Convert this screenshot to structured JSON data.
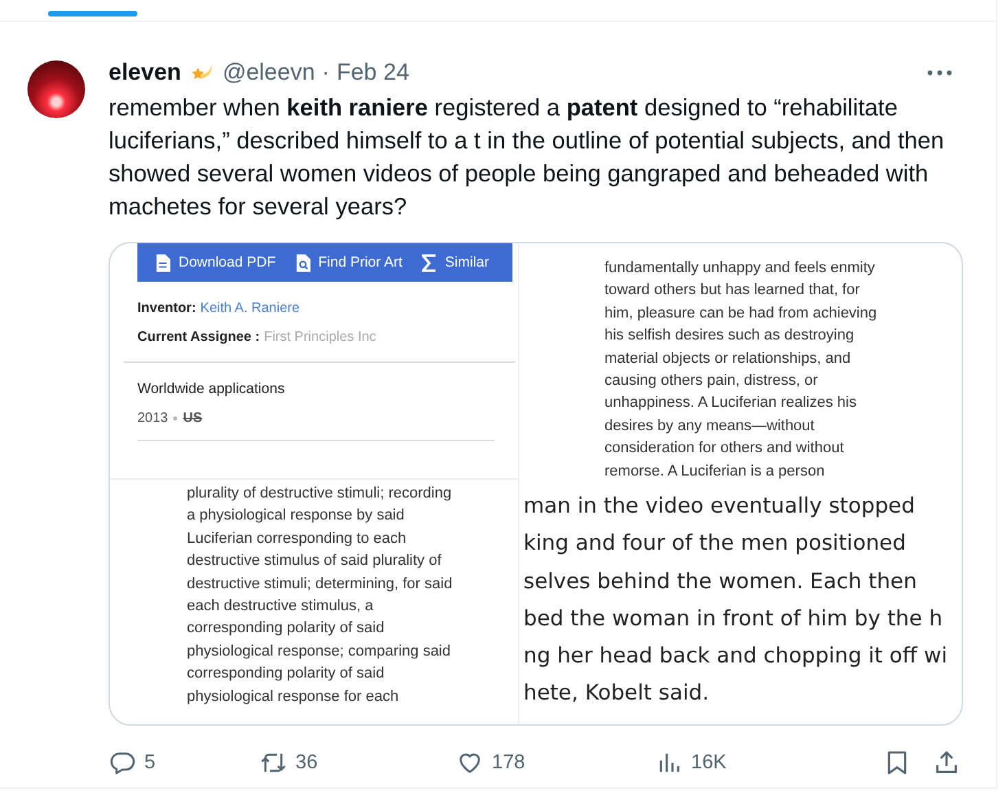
{
  "tweet": {
    "author": "eleven",
    "handle": "@eleevn",
    "separator": "·",
    "date": "Feb 24",
    "text": "remember when **keith raniere** registered a **patent** designed to “rehabilitate luciferians,” described himself to a t in the outline of potential subjects, and then showed several women videos of people being gangraped and beheaded with machetes for several years?"
  },
  "media": {
    "patent_page": {
      "toolbar": [
        {
          "kind": "document",
          "label": "Download PDF"
        },
        {
          "kind": "search",
          "label": "Find Prior Art"
        },
        {
          "kind": "sigma",
          "label": "Similar"
        }
      ],
      "fields": [
        {
          "label": "Inventor:",
          "value": "Keith A. Raniere",
          "kind": "link"
        },
        {
          "label": "Current Assignee :",
          "value": "First Principles Inc",
          "kind": "muted"
        }
      ],
      "section_title": "Worldwide applications",
      "year": "2013",
      "country": "US"
    },
    "description_lines": [
      "fundamentally unhappy and feels enmity",
      "toward others but has learned that, for",
      "him, pleasure can be had from achieving",
      "his selfish desires such as destroying",
      "material objects or relationships, and",
      "causing others pain, distress, or",
      "unhappiness. A Luciferian realizes his",
      "desires by any means—without",
      "consideration for others and without",
      "remorse. A Luciferian is a person"
    ],
    "claim_lines": [
      "plurality of destructive stimuli; recording",
      "a physiological response by said",
      "Luciferian corresponding to each",
      "destructive stimulus of said plurality of",
      "destructive stimuli; determining, for said",
      "each destructive stimulus, a",
      "corresponding polarity of said",
      "physiological response; comparing said",
      "corresponding polarity of said",
      "physiological response for each"
    ],
    "article_lines": [
      "man in the video eventually stopped",
      "king and four of the men positioned",
      "selves behind the women. Each then",
      "bed the woman in front of him by the h",
      "ng her head back and chopping it off wi",
      "hete, Kobelt said."
    ]
  },
  "actions": [
    {
      "kind": "reply",
      "count": "5"
    },
    {
      "kind": "repost",
      "count": "36"
    },
    {
      "kind": "like",
      "count": "178"
    },
    {
      "kind": "views",
      "count": "16K"
    },
    {
      "kind": "bookmark"
    },
    {
      "kind": "share"
    }
  ]
}
